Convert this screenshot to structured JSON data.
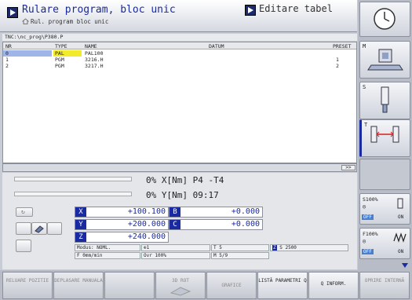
{
  "header": {
    "mode_title": "Rulare program, bloc unic",
    "mode_subtitle": "Rul. program bloc unic",
    "edit_title": "Editare tabel"
  },
  "path": "TNC:\\nc_prog\\P380.P",
  "table": {
    "columns": [
      "NR",
      "TYPE",
      "NAME",
      "DATUM",
      "PRESET"
    ],
    "rows": [
      {
        "nr": "0",
        "type": "PAL",
        "name": "PAL100",
        "datum": "",
        "preset": ""
      },
      {
        "nr": "1",
        "type": "PGM",
        "name": "3216.H",
        "datum": "",
        "preset": "1"
      },
      {
        "nr": "2",
        "type": "PGM",
        "name": "3217.H",
        "datum": "",
        "preset": "2"
      }
    ]
  },
  "scroll_button": ">>",
  "status": {
    "line1": "0% X[Nm] P4  -T4",
    "line2": "0% Y[Nm] 09:17"
  },
  "axes": [
    {
      "label": "X",
      "value": "+100.100"
    },
    {
      "label": "B",
      "value": "+0.000"
    },
    {
      "label": "Y",
      "value": "+200.000"
    },
    {
      "label": "C",
      "value": "+0.000"
    },
    {
      "label": "Z",
      "value": "+240.000"
    }
  ],
  "info": {
    "mode": "Modus: NOML.",
    "datum": "1",
    "tool": "T 5",
    "spindle_label": "Z",
    "spindle": "S 2500",
    "feed": "F 0mm/min",
    "ovr": "Ovr 100%",
    "m": "M 5/9"
  },
  "right_softkeys": {
    "m_label": "M",
    "s_label": "S",
    "t_label": "T",
    "s_override": "S100%",
    "s_off": "OFF",
    "s_on": "ON",
    "f_override": "F100%",
    "f_off": "OFF",
    "f_on": "ON"
  },
  "bottom_softkeys": [
    {
      "label": "RELUARE POZITIE",
      "active": false
    },
    {
      "label": "DEPLASARE MANUALA",
      "active": false
    },
    {
      "label": "",
      "active": false
    },
    {
      "label": "3D ROT",
      "active": false
    },
    {
      "label": "GRAFICE",
      "active": false
    },
    {
      "label": "LISTĂ PARAMETRI Q",
      "active": true
    },
    {
      "label": "Q INFORM.",
      "active": true
    },
    {
      "label": "OPRIRE INTERNĂ",
      "active": false
    }
  ],
  "colors": {
    "accent": "#1a2aa0",
    "highlight": "#f2ea2c",
    "selected_row": "#9fb4e8"
  }
}
